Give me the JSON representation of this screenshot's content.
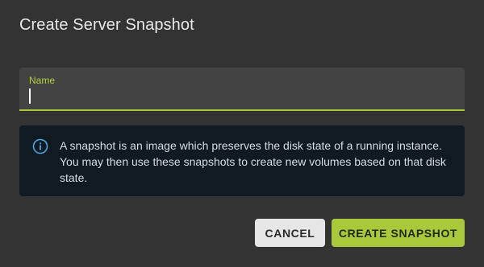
{
  "dialog": {
    "title": "Create Server Snapshot"
  },
  "name_field": {
    "label": "Name",
    "value": "",
    "placeholder": ""
  },
  "info": {
    "icon": "info-icon",
    "text": "A snapshot is an image which preserves the disk state of a running instance. You may then use these snapshots to create new volumes based on that disk state."
  },
  "actions": {
    "cancel_label": "CANCEL",
    "create_label": "CREATE SNAPSHOT"
  },
  "colors": {
    "accent": "#a9c93a",
    "background": "#333333",
    "info_background": "#0f1a22",
    "info_icon": "#4aa8e0"
  }
}
